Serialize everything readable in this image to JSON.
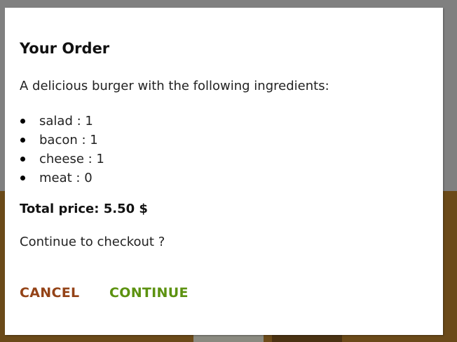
{
  "modal": {
    "title": "Your Order",
    "description": "A delicious burger with the following ingredients:",
    "ingredients": [
      {
        "text": "salad : 1"
      },
      {
        "text": "bacon : 1"
      },
      {
        "text": "cheese : 1"
      },
      {
        "text": "meat : 0"
      }
    ],
    "total_price": "Total price: 5.50 $",
    "prompt": "Continue to checkout ?",
    "cancel_label": "CANCEL",
    "continue_label": "CONTINUE"
  },
  "colors": {
    "cancel": "#944317",
    "continue": "#5c9210",
    "backdrop": "#808080",
    "background_brown": "#6b4a19"
  }
}
